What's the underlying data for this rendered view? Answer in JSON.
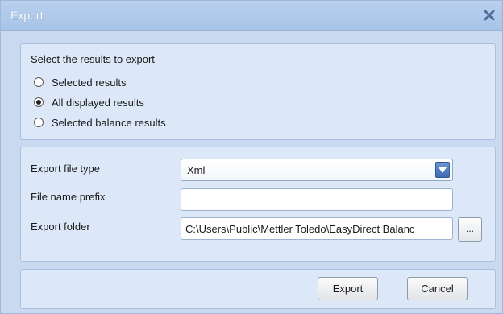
{
  "window": {
    "title": "Export",
    "colors": {
      "titlebar": "#b9d0ee",
      "background": "#c9daf0",
      "panel": "#dce8f7",
      "accent": "#3e6cb2"
    }
  },
  "results_section": {
    "label": "Select the results to export",
    "options": [
      {
        "label": "Selected results",
        "checked": false
      },
      {
        "label": "All displayed results",
        "checked": true
      },
      {
        "label": "Selected balance results",
        "checked": false
      }
    ]
  },
  "file_section": {
    "file_type_label": "Export file type",
    "file_type_value": "Xml",
    "prefix_label": "File name prefix",
    "prefix_value": "",
    "folder_label": "Export folder",
    "folder_value": "C:\\Users\\Public\\Mettler Toledo\\EasyDirect Balanc",
    "browse_label": "..."
  },
  "buttons": {
    "export_label": "Export",
    "cancel_label": "Cancel"
  }
}
